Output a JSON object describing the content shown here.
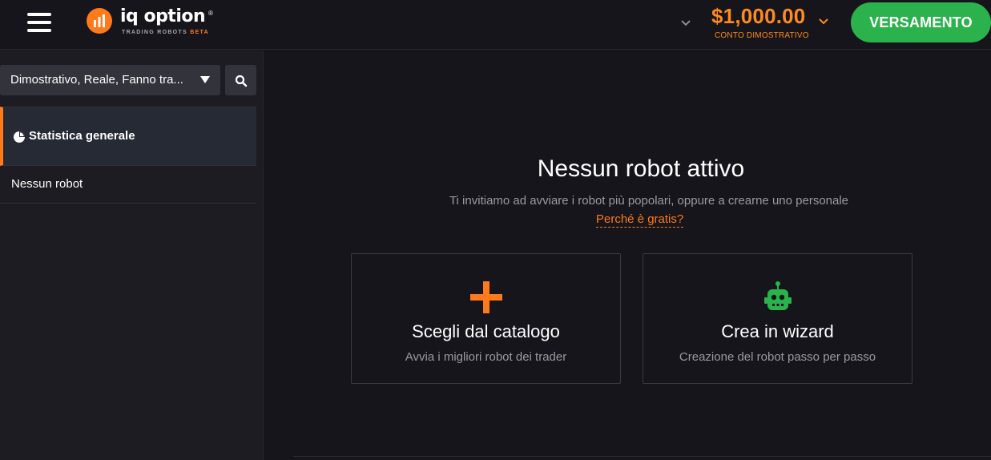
{
  "header": {
    "logo": {
      "name": "iq option",
      "registered": "®",
      "subtitle": "TRADING ROBOTS",
      "badge": "BETA"
    },
    "balance": {
      "amount": "$1,000.00",
      "account_type": "CONTO DIMOSTRATIVO"
    },
    "deposit_label": "VERSAMENTO",
    "icons": [
      "hamburger-menu-icon",
      "chevron-down-icon",
      "search-icon",
      "pie-chart-icon",
      "plus-icon",
      "robot-icon"
    ]
  },
  "sidebar": {
    "filter_value": "Dimostrativo, Reale, Fanno tra...",
    "items": [
      {
        "label": "Statistica generale",
        "active": true
      },
      {
        "label": "Nessun robot",
        "active": false
      }
    ]
  },
  "main": {
    "title": "Nessun robot attivo",
    "subtitle": "Ti invitiamo ad avviare i robot più popolari, oppure a crearne uno personale",
    "why_link": "Perché è gratis?",
    "cards": [
      {
        "title": "Scegli dal catalogo",
        "description": "Avvia i migliori robot dei trader"
      },
      {
        "title": "Crea in wizard",
        "description": "Creazione del robot passo per passo"
      }
    ]
  },
  "colors": {
    "accent": "#ff7a1a",
    "deposit": "#2bb24c",
    "robot": "#2bb24c",
    "background": "#15151b",
    "sidebar": "#1c1c22"
  }
}
